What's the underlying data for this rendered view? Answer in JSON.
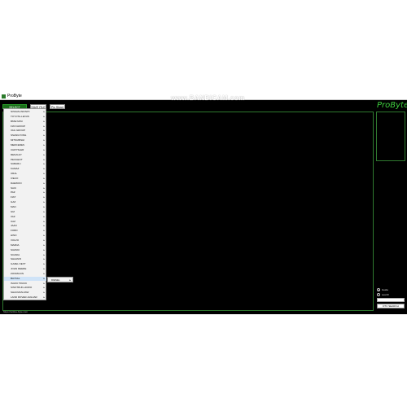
{
  "window": {
    "title": "ProByte"
  },
  "watermark": "www.BANDICAM.com",
  "toolbar": {
    "select_tab": "SELECT VEHICLE",
    "save_tab": "SAVE FILE",
    "new_tab": "Pin Sheet"
  },
  "logo": "ProByte",
  "vehicle_list": [
    "NISSAN-INFINITI",
    "TOYOTA-LEXUS",
    "BMW-MINI",
    "FIAT-GROUP",
    "VAG GROUP",
    "SSANGYONG",
    "MITSUBISHI",
    "MERCEDES",
    "CHRYSLER",
    "RENAULT",
    "PEUGEOT",
    "SUBARU",
    "KAMAZ",
    "URAL",
    "IVECO",
    "DAEWOO",
    "SAIC",
    "PAZ",
    "FIAT",
    "GAZ",
    "MAN",
    "GM",
    "VAZ",
    "UAZ",
    "JAAN",
    "FORD",
    "HINO",
    "VOLVO",
    "MAZDA",
    "SUZUKI",
    "SCANIA",
    "SHAANXI",
    "GAZEL NEXT",
    "JOHN DEERE",
    "ZOOMLION",
    "BAYKAL",
    "ISUZU TRUCK",
    "SINOTRUK-HOWO",
    "SHACMAN-FAW",
    "LAND ROVER-JAGUAR"
  ],
  "highlighted_item": "BAYKAL",
  "submenu": {
    "item": "DIESEL"
  },
  "side": {
    "radio_1": "Guide",
    "radio_2": "search",
    "search_button": "DTC SEARCH"
  },
  "status": {
    "link": "https://online-byte.com"
  }
}
